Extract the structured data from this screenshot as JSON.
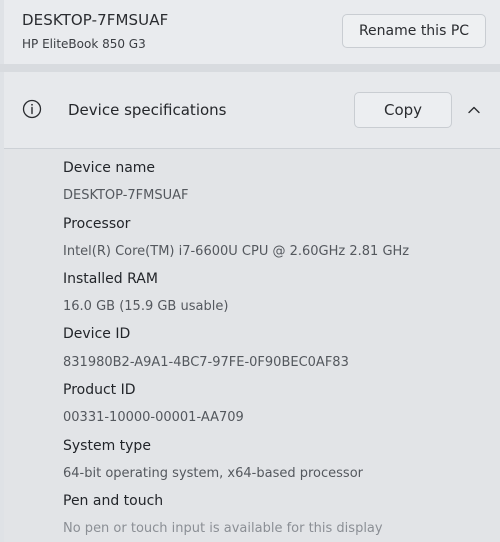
{
  "pc": {
    "name": "DESKTOP-7FMSUAF",
    "model": "HP EliteBook 850 G3",
    "rename_label": "Rename this PC"
  },
  "specs_header": {
    "icon": "info-icon",
    "title": "Device specifications",
    "copy_label": "Copy",
    "collapse_icon": "chevron-up-icon"
  },
  "specs": [
    {
      "label": "Device name",
      "value": "DESKTOP-7FMSUAF"
    },
    {
      "label": "Processor",
      "value": "Intel(R) Core(TM) i7-6600U CPU @ 2.60GHz   2.81 GHz"
    },
    {
      "label": "Installed RAM",
      "value": "16.0 GB (15.9 GB usable)"
    },
    {
      "label": "Device ID",
      "value": "831980B2-A9A1-4BC7-97FE-0F90BEC0AF83"
    },
    {
      "label": "Product ID",
      "value": "00331-10000-00001-AA709"
    },
    {
      "label": "System type",
      "value": "64-bit operating system, x64-based processor"
    },
    {
      "label": "Pen and touch",
      "value": "No pen or touch input is available for this display"
    }
  ]
}
